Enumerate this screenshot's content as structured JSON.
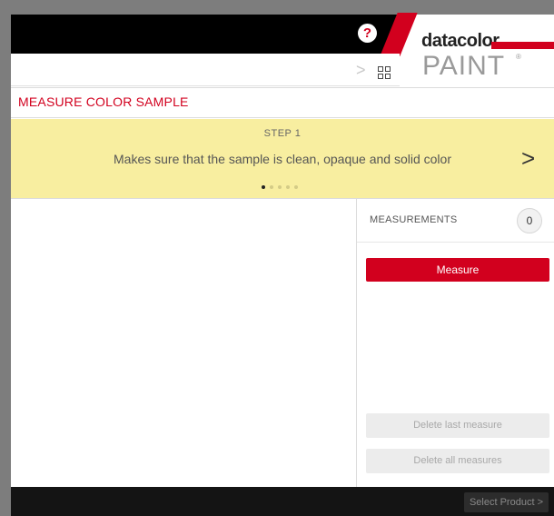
{
  "header": {
    "help_glyph": "?",
    "logo": {
      "brand": "datacolor",
      "product": "PAINT",
      "registered": "®"
    },
    "nav_chevron": ">",
    "grid_icon": "grid-icon"
  },
  "section": {
    "title": "MEASURE COLOR SAMPLE"
  },
  "step": {
    "label": "STEP 1",
    "text": "Makes sure that the sample is clean, opaque and solid color",
    "next_glyph": ">",
    "current_page": 1,
    "total_pages": 5
  },
  "measurements": {
    "label": "MEASUREMENTS",
    "count": "0",
    "measure_button": "Measure",
    "delete_last": "Delete last measure",
    "delete_all": "Delete all measures"
  },
  "footer": {
    "select_product": "Select Product >"
  },
  "colors": {
    "accent": "#d2001e",
    "banner": "#f8eea0",
    "topbar": "#000000"
  }
}
